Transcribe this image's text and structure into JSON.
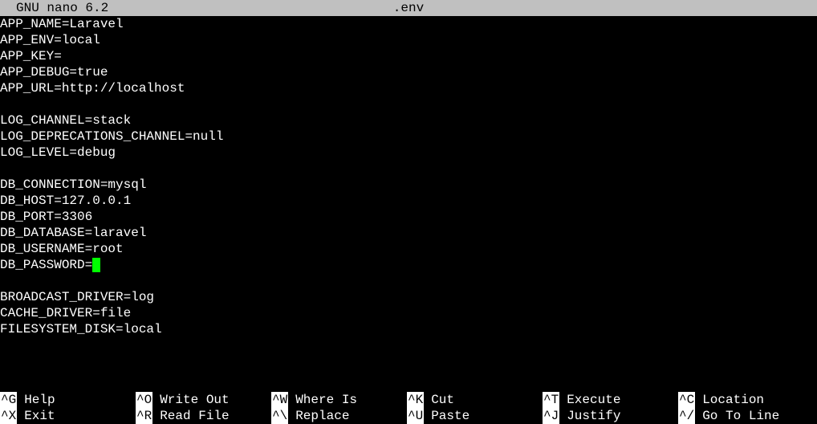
{
  "titlebar": {
    "app": "GNU nano 6.2",
    "filename": ".env"
  },
  "content": {
    "lines": [
      "APP_NAME=Laravel",
      "APP_ENV=local",
      "APP_KEY=",
      "APP_DEBUG=true",
      "APP_URL=http://localhost",
      "",
      "LOG_CHANNEL=stack",
      "LOG_DEPRECATIONS_CHANNEL=null",
      "LOG_LEVEL=debug",
      "",
      "DB_CONNECTION=mysql",
      "DB_HOST=127.0.0.1",
      "DB_PORT=3306",
      "DB_DATABASE=laravel",
      "DB_USERNAME=root",
      "DB_PASSWORD=",
      "",
      "BROADCAST_DRIVER=log",
      "CACHE_DRIVER=file",
      "FILESYSTEM_DISK=local"
    ],
    "cursor_line": 15
  },
  "shortcuts": {
    "row1": [
      {
        "key": "^G",
        "label": "Help"
      },
      {
        "key": "^O",
        "label": "Write Out"
      },
      {
        "key": "^W",
        "label": "Where Is"
      },
      {
        "key": "^K",
        "label": "Cut"
      },
      {
        "key": "^T",
        "label": "Execute"
      },
      {
        "key": "^C",
        "label": "Location"
      }
    ],
    "row2": [
      {
        "key": "^X",
        "label": "Exit"
      },
      {
        "key": "^R",
        "label": "Read File"
      },
      {
        "key": "^\\",
        "label": "Replace"
      },
      {
        "key": "^U",
        "label": "Paste"
      },
      {
        "key": "^J",
        "label": "Justify"
      },
      {
        "key": "^/",
        "label": "Go To Line"
      }
    ]
  }
}
